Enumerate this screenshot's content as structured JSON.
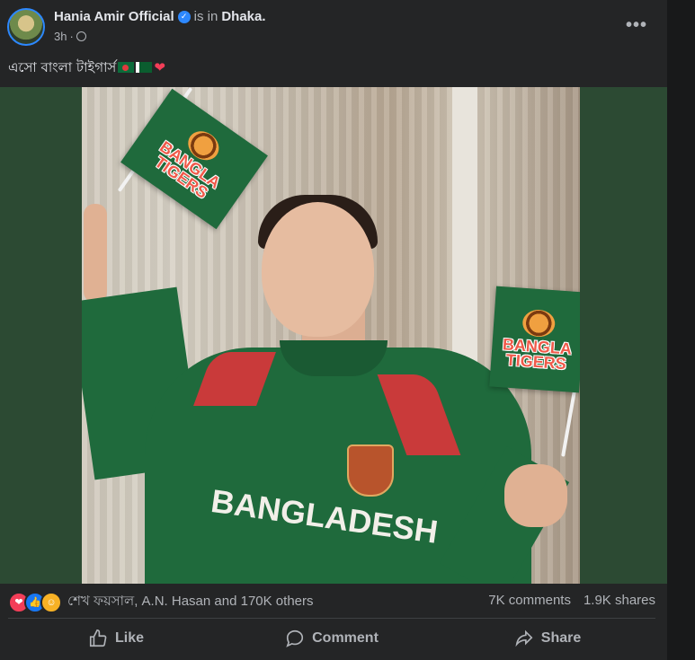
{
  "post": {
    "author": "Hania Amir Official",
    "is_in_text": "is in",
    "place": "Dhaka",
    "place_suffix": ".",
    "time": "3h",
    "caption": "এসো বাংলা টাইগার্স",
    "more_icon": "more-horizontal-icon"
  },
  "photo": {
    "jersey_text": "BANGLADESH",
    "flag_text_line1": "BANGLA",
    "flag_text_line2": "TIGERS"
  },
  "engagement": {
    "reaction_icons": [
      "love-icon",
      "like-icon",
      "care-icon"
    ],
    "reactions_summary": "শেখ ফয়সাল, A.N. Hasan and 170K others",
    "comments": "7K comments",
    "shares": "1.9K shares"
  },
  "actions": {
    "like": "Like",
    "comment": "Comment",
    "share": "Share"
  },
  "colors": {
    "background": "#242526",
    "accent": "#2d88ff",
    "secondary_text": "#b0b3b8",
    "love": "#f33e58",
    "like": "#1877f2"
  }
}
